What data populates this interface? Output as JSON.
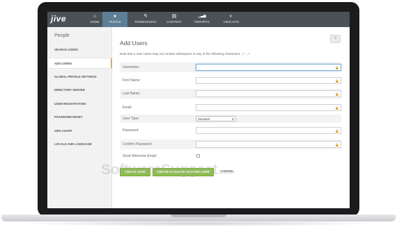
{
  "app": {
    "logo": "jive"
  },
  "nav": {
    "items": [
      {
        "label": "HOME",
        "icon": "home-icon",
        "glyph": "⌂",
        "active": false
      },
      {
        "label": "PEOPLE",
        "icon": "person-icon",
        "glyph": "●",
        "active": true
      },
      {
        "label": "PERMISSIONS",
        "icon": "wrench-icon",
        "glyph": "✎",
        "active": false
      },
      {
        "label": "CONTENT",
        "icon": "document-icon",
        "glyph": "▤",
        "active": false
      },
      {
        "label": "REPORTS",
        "icon": "chart-icon",
        "glyph": "▁▃▅",
        "active": false
      },
      {
        "label": "VIEW SITE",
        "icon": "globe-icon",
        "glyph": "◐",
        "active": false
      }
    ]
  },
  "sidebar": {
    "title": "People",
    "items": [
      {
        "label": "SEARCH USERS",
        "active": false
      },
      {
        "label": "ADD USERS",
        "active": true
      },
      {
        "label": "GLOBAL PROFILE SETTINGS",
        "active": false
      },
      {
        "label": "DIRECTORY SERVER",
        "active": false
      },
      {
        "label": "USER REGISTRATION",
        "active": false
      },
      {
        "label": "PASSWORD RESET",
        "active": false
      },
      {
        "label": "ORG CHART",
        "active": false
      },
      {
        "label": "LOCALE AND LANGUAGE",
        "active": false
      }
    ]
  },
  "main": {
    "title": "Add Users",
    "help_label": "?",
    "note": "Note that a user name may not contain whitespace or any of the following characters: , / : ; \\",
    "fields": {
      "username": {
        "label": "Username:",
        "value": ""
      },
      "first_name": {
        "label": "First Name:",
        "value": ""
      },
      "last_name": {
        "label": "Last Name:",
        "value": ""
      },
      "email": {
        "label": "Email:",
        "value": ""
      },
      "user_type": {
        "label": "User Type:",
        "value": "Standard"
      },
      "password": {
        "label": "Password:",
        "value": ""
      },
      "confirm_password": {
        "label": "Confirm Password:",
        "value": ""
      },
      "send_welcome": {
        "label": "Send Welcome Email:",
        "checked": false
      }
    },
    "lock_glyph": "🔒",
    "buttons": {
      "create": "CREATE USER",
      "create_another": "CREATE & CREATE ANOTHER USER",
      "cancel": "CANCEL"
    }
  },
  "watermark": {
    "text": "SoftwareSuggest",
    "suffix": ".com"
  },
  "colors": {
    "nav_bg": "#4b5157",
    "nav_active": "#5d7e95",
    "accent": "#f1a83b",
    "button_green": "#8cbf4a"
  }
}
